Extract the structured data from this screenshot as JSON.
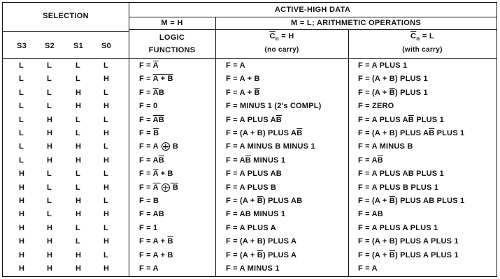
{
  "header": {
    "selection": "SELECTION",
    "active_high": "ACTIVE-HIGH DATA",
    "m_h": "M = H",
    "m_l": "M = L; ARITHMETIC OPERATIONS",
    "logic_1": "LOGIC",
    "logic_2": "FUNCTIONS",
    "cn_h_pre": "C",
    "cn_sub": "n",
    "cn_h_post": " = H",
    "cn_h_note": "(no carry)",
    "cn_l_post": " = L",
    "cn_l_note": "(with carry)",
    "s3": "S3",
    "s2": "S2",
    "s1": "S1",
    "s0": "S0"
  },
  "rows": [
    {
      "s": [
        "L",
        "L",
        "L",
        "L"
      ],
      "logic": [
        [
          "F = ",
          ""
        ],
        [
          "A",
          "o"
        ]
      ],
      "nocarry": [
        [
          "F = A",
          ""
        ]
      ],
      "carry": [
        [
          "F = A PLUS 1",
          ""
        ]
      ]
    },
    {
      "s": [
        "L",
        "L",
        "L",
        "H"
      ],
      "logic": [
        [
          "F = ",
          ""
        ],
        [
          "A + B",
          "o"
        ]
      ],
      "nocarry": [
        [
          "F = A + B",
          ""
        ]
      ],
      "carry": [
        [
          "F = (A + B) PLUS 1",
          ""
        ]
      ]
    },
    {
      "s": [
        "L",
        "L",
        "H",
        "L"
      ],
      "logic": [
        [
          "F = ",
          ""
        ],
        [
          "A",
          "o"
        ],
        [
          "B",
          ""
        ]
      ],
      "nocarry": [
        [
          "F = A + ",
          ""
        ],
        [
          "B",
          "o"
        ]
      ],
      "carry": [
        [
          "F = (A + ",
          ""
        ],
        [
          "B",
          "o"
        ],
        [
          ") PLUS 1",
          ""
        ]
      ]
    },
    {
      "s": [
        "L",
        "L",
        "H",
        "H"
      ],
      "logic": [
        [
          "F = 0",
          ""
        ]
      ],
      "nocarry": [
        [
          "F = MINUS 1 (2's COMPL)",
          ""
        ]
      ],
      "carry": [
        [
          "F = ZERO",
          ""
        ]
      ]
    },
    {
      "s": [
        "L",
        "H",
        "L",
        "L"
      ],
      "logic": [
        [
          "F = ",
          ""
        ],
        [
          "AB",
          "o"
        ]
      ],
      "nocarry": [
        [
          "F = A PLUS A",
          ""
        ],
        [
          "B",
          "o"
        ]
      ],
      "carry": [
        [
          "F = A PLUS A",
          ""
        ],
        [
          "B",
          "o"
        ],
        [
          " PLUS 1",
          ""
        ]
      ]
    },
    {
      "s": [
        "L",
        "H",
        "L",
        "H"
      ],
      "logic": [
        [
          "F = ",
          ""
        ],
        [
          "B",
          "o"
        ]
      ],
      "nocarry": [
        [
          "F = (A + B) PLUS A",
          ""
        ],
        [
          "B",
          "o"
        ]
      ],
      "carry": [
        [
          "F = (A + B) PLUS A",
          ""
        ],
        [
          "B",
          "o"
        ],
        [
          " PLUS 1",
          ""
        ]
      ]
    },
    {
      "s": [
        "L",
        "H",
        "H",
        "L"
      ],
      "logic": [
        [
          "F = A ",
          ""
        ],
        [
          "xor",
          "x"
        ],
        [
          " B",
          ""
        ]
      ],
      "nocarry": [
        [
          "F = A MINUS B MINUS 1",
          ""
        ]
      ],
      "carry": [
        [
          "F = A MINUS B",
          ""
        ]
      ]
    },
    {
      "s": [
        "L",
        "H",
        "H",
        "H"
      ],
      "logic": [
        [
          "F = A",
          ""
        ],
        [
          "B",
          "o"
        ]
      ],
      "nocarry": [
        [
          "F = A",
          ""
        ],
        [
          "B",
          "o"
        ],
        [
          " MINUS 1",
          ""
        ]
      ],
      "carry": [
        [
          "F = A",
          ""
        ],
        [
          "B",
          "o"
        ]
      ]
    },
    {
      "s": [
        "H",
        "L",
        "L",
        "L"
      ],
      "logic": [
        [
          "F = ",
          ""
        ],
        [
          "A",
          "o"
        ],
        [
          " + B",
          ""
        ]
      ],
      "nocarry": [
        [
          "F = A PLUS AB",
          ""
        ]
      ],
      "carry": [
        [
          "F = A PLUS AB PLUS 1",
          ""
        ]
      ]
    },
    {
      "s": [
        "H",
        "L",
        "L",
        "H"
      ],
      "logic": [
        [
          "F = ",
          ""
        ],
        [
          "A ",
          "o"
        ],
        [
          "xor",
          "x"
        ],
        [
          " B",
          "o"
        ]
      ],
      "nocarry": [
        [
          "F = A PLUS B",
          ""
        ]
      ],
      "carry": [
        [
          "F = A PLUS B PLUS 1",
          ""
        ]
      ]
    },
    {
      "s": [
        "H",
        "L",
        "H",
        "L"
      ],
      "logic": [
        [
          "F = B",
          ""
        ]
      ],
      "nocarry": [
        [
          "F = (A + ",
          ""
        ],
        [
          "B",
          "o"
        ],
        [
          ") PLUS AB",
          ""
        ]
      ],
      "carry": [
        [
          "F = (A + ",
          ""
        ],
        [
          "B",
          "o"
        ],
        [
          ") PLUS AB PLUS 1",
          ""
        ]
      ]
    },
    {
      "s": [
        "H",
        "L",
        "H",
        "H"
      ],
      "logic": [
        [
          "F = AB",
          ""
        ]
      ],
      "nocarry": [
        [
          "F = AB MINUS 1",
          ""
        ]
      ],
      "carry": [
        [
          "F = AB",
          ""
        ]
      ]
    },
    {
      "s": [
        "H",
        "H",
        "L",
        "L"
      ],
      "logic": [
        [
          "F = 1",
          ""
        ]
      ],
      "nocarry": [
        [
          "F  =  A PLUS A",
          ""
        ]
      ],
      "carry": [
        [
          "F = A PLUS A PLUS 1",
          ""
        ]
      ]
    },
    {
      "s": [
        "H",
        "H",
        "L",
        "H"
      ],
      "logic": [
        [
          "F = A + ",
          ""
        ],
        [
          "B",
          "o"
        ]
      ],
      "nocarry": [
        [
          "F = (A + B) PLUS A",
          ""
        ]
      ],
      "carry": [
        [
          "F = (A + B) PLUS A PLUS 1",
          ""
        ]
      ]
    },
    {
      "s": [
        "H",
        "H",
        "H",
        "L"
      ],
      "logic": [
        [
          "F = A + B",
          ""
        ]
      ],
      "nocarry": [
        [
          "F = (A + ",
          ""
        ],
        [
          "B",
          "o"
        ],
        [
          ") PLUS A",
          ""
        ]
      ],
      "carry": [
        [
          "F = (A + ",
          ""
        ],
        [
          "B",
          "o"
        ],
        [
          ") PLUS A PLUS 1",
          ""
        ]
      ]
    },
    {
      "s": [
        "H",
        "H",
        "H",
        "H"
      ],
      "logic": [
        [
          "F = A",
          ""
        ]
      ],
      "nocarry": [
        [
          "F = A MINUS 1",
          ""
        ]
      ],
      "carry": [
        [
          "F = A",
          ""
        ]
      ]
    }
  ]
}
